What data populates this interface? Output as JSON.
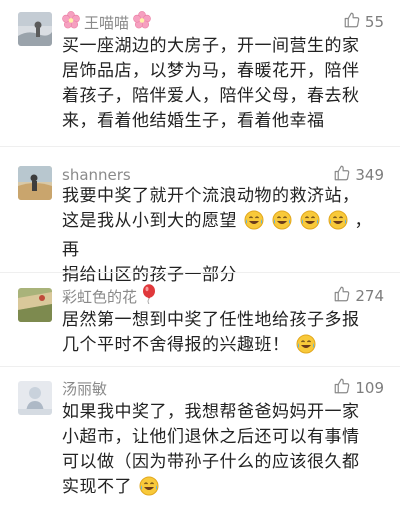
{
  "colors": {
    "accent_pink": "#f07aa6",
    "balloon": "#e0383b",
    "muted_text": "#8a8a8a",
    "body_text": "#222222"
  },
  "icons": {
    "like": "thumbs-up-icon",
    "flower": "cherry-blossom-icon",
    "balloon": "balloon-icon",
    "laugh_cry": "face-with-tears-of-joy-icon"
  },
  "comments": [
    {
      "username": "王喵喵",
      "likes": "55",
      "lines": [
        "买一座湖边的大房子，开一间营生的家",
        "居饰品店，以梦为马，春暖花开，陪伴",
        "着孩子，陪伴爱人，陪伴父母，春去秋",
        "来，看着他结婚生子，看着他幸福"
      ]
    },
    {
      "username": "shanners",
      "likes": "349",
      "lines": [
        "我要中奖了就开个流浪动物的救济站，",
        "这是我从小到大的愿望",
        "，再",
        "捐给山区的孩子一部分"
      ]
    },
    {
      "username": "彩虹色的花",
      "likes": "274",
      "lines": [
        "居然第一想到中奖了任性地给孩子多报",
        "几个平时不舍得报的兴趣班！"
      ]
    },
    {
      "username": "汤丽敏",
      "likes": "109",
      "lines": [
        "如果我中奖了，我想帮爸爸妈妈开一家",
        "小超市，让他们退休之后还可以有事情",
        "可以做（因为带孙子什么的应该很久都",
        "实现不了"
      ]
    }
  ]
}
